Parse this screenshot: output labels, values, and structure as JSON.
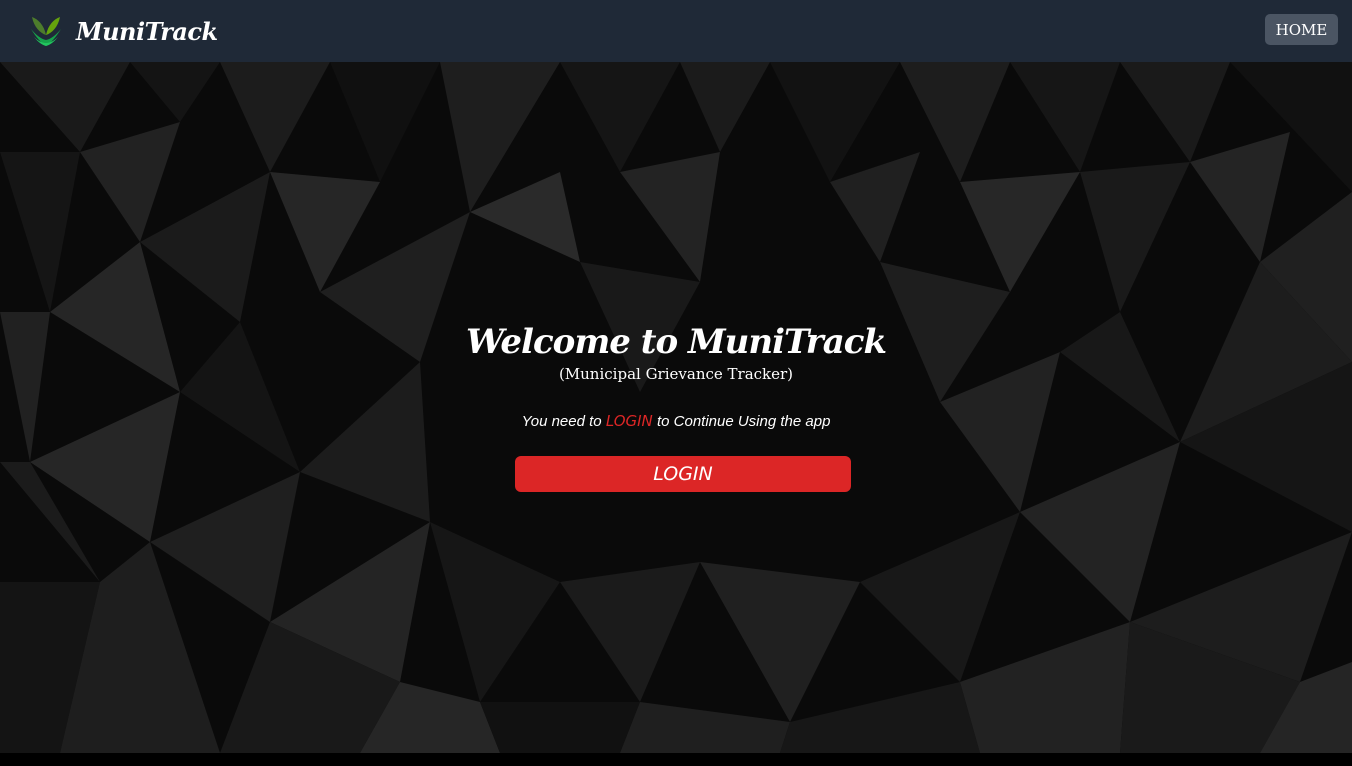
{
  "navbar": {
    "brand_name": "MuniTrack",
    "home_label": "HOME"
  },
  "hero": {
    "title": "Welcome to MuniTrack",
    "subtitle": "(Municipal Grievance Tracker)",
    "note_prefix": "You need to ",
    "note_link": "LOGIN",
    "note_suffix": " to Continue Using the app",
    "login_button": "LOGIN"
  },
  "colors": {
    "navbar_bg": "#1f2937",
    "home_button_bg": "#4b5563",
    "accent_red": "#dc2626",
    "logo_green": "#16a34a"
  },
  "icons": {
    "brand_logo": "leaf-logo-icon"
  }
}
